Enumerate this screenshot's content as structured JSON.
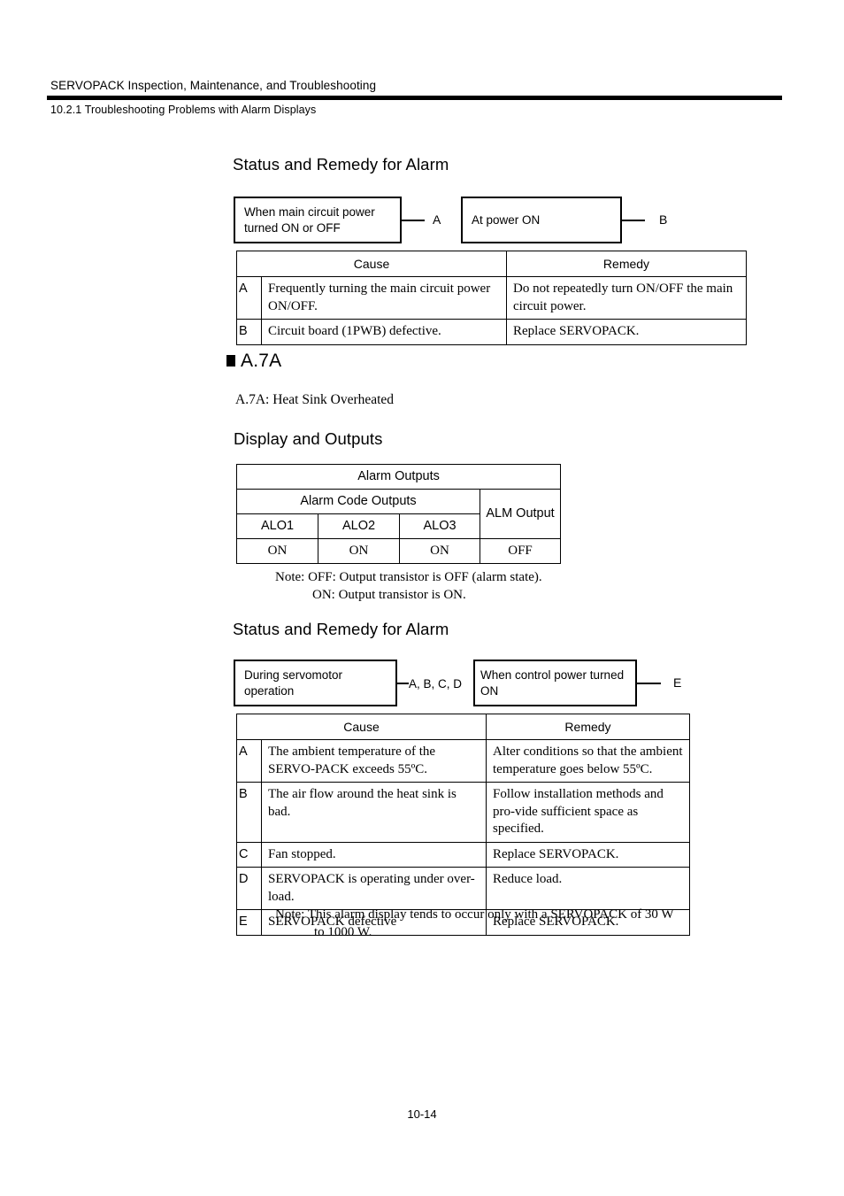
{
  "header": {
    "title": "SERVOPACK Inspection, Maintenance, and Troubleshooting",
    "subsection": "10.2.1  Troubleshooting Problems with Alarm Displays"
  },
  "section_one": {
    "heading": "Status and Remedy for Alarm",
    "diagram": {
      "box1": "When main circuit power turned ON or OFF",
      "label1": "A",
      "box2": "At power ON",
      "label2": "B"
    },
    "table": {
      "columns": [
        "Cause",
        "Remedy"
      ],
      "rows": [
        {
          "index": "A",
          "cause": "Frequently turning the main circuit power ON/OFF.",
          "remedy": "Do not repeatedly turn ON/OFF the main circuit power."
        },
        {
          "index": "B",
          "cause": "Circuit board (1PWB) defective.",
          "remedy": "Replace SERVOPACK."
        }
      ]
    }
  },
  "alarm": {
    "code": "A.7A",
    "description": "A.7A: Heat Sink Overheated",
    "display_outputs_heading": "Display and Outputs",
    "outputs_table": {
      "title": "Alarm Outputs",
      "group_header": "Alarm Code Outputs",
      "alm_header": "ALM Output",
      "code_columns": [
        "ALO1",
        "ALO2",
        "ALO3"
      ],
      "code_values": [
        "ON",
        "ON",
        "ON"
      ],
      "alm_value": "OFF"
    },
    "outputs_note": {
      "line1": "Note: OFF: Output transistor is OFF (alarm state).",
      "line2": "ON: Output transistor is ON."
    }
  },
  "section_two": {
    "heading": "Status and Remedy for Alarm",
    "diagram": {
      "box1": "During servomotor operation",
      "label1": "A, B, C, D",
      "box2": "When control power turned ON",
      "label2": "E"
    },
    "table": {
      "columns": [
        "Cause",
        "Remedy"
      ],
      "rows": [
        {
          "index": "A",
          "cause": "The ambient temperature of the SERVO-PACK exceeds 55ºC.",
          "remedy": "Alter conditions so that the ambient temperature goes below 55ºC."
        },
        {
          "index": "B",
          "cause": "The air flow around the heat sink is bad.",
          "remedy": "Follow installation methods and pro-vide sufficient space as specified."
        },
        {
          "index": "C",
          "cause": "Fan stopped.",
          "remedy": "Replace SERVOPACK."
        },
        {
          "index": "D",
          "cause": "SERVOPACK is operating under over-load.",
          "remedy": "Reduce load."
        },
        {
          "index": "E",
          "cause": "SERVOPACK defective",
          "remedy": "Replace SERVOPACK."
        }
      ]
    },
    "note": {
      "line1": "Note: This alarm display tends to occur only with a SERVOPACK of 30 W",
      "line2": "to 1000 W."
    }
  },
  "footer": {
    "page_number": "10-14"
  }
}
